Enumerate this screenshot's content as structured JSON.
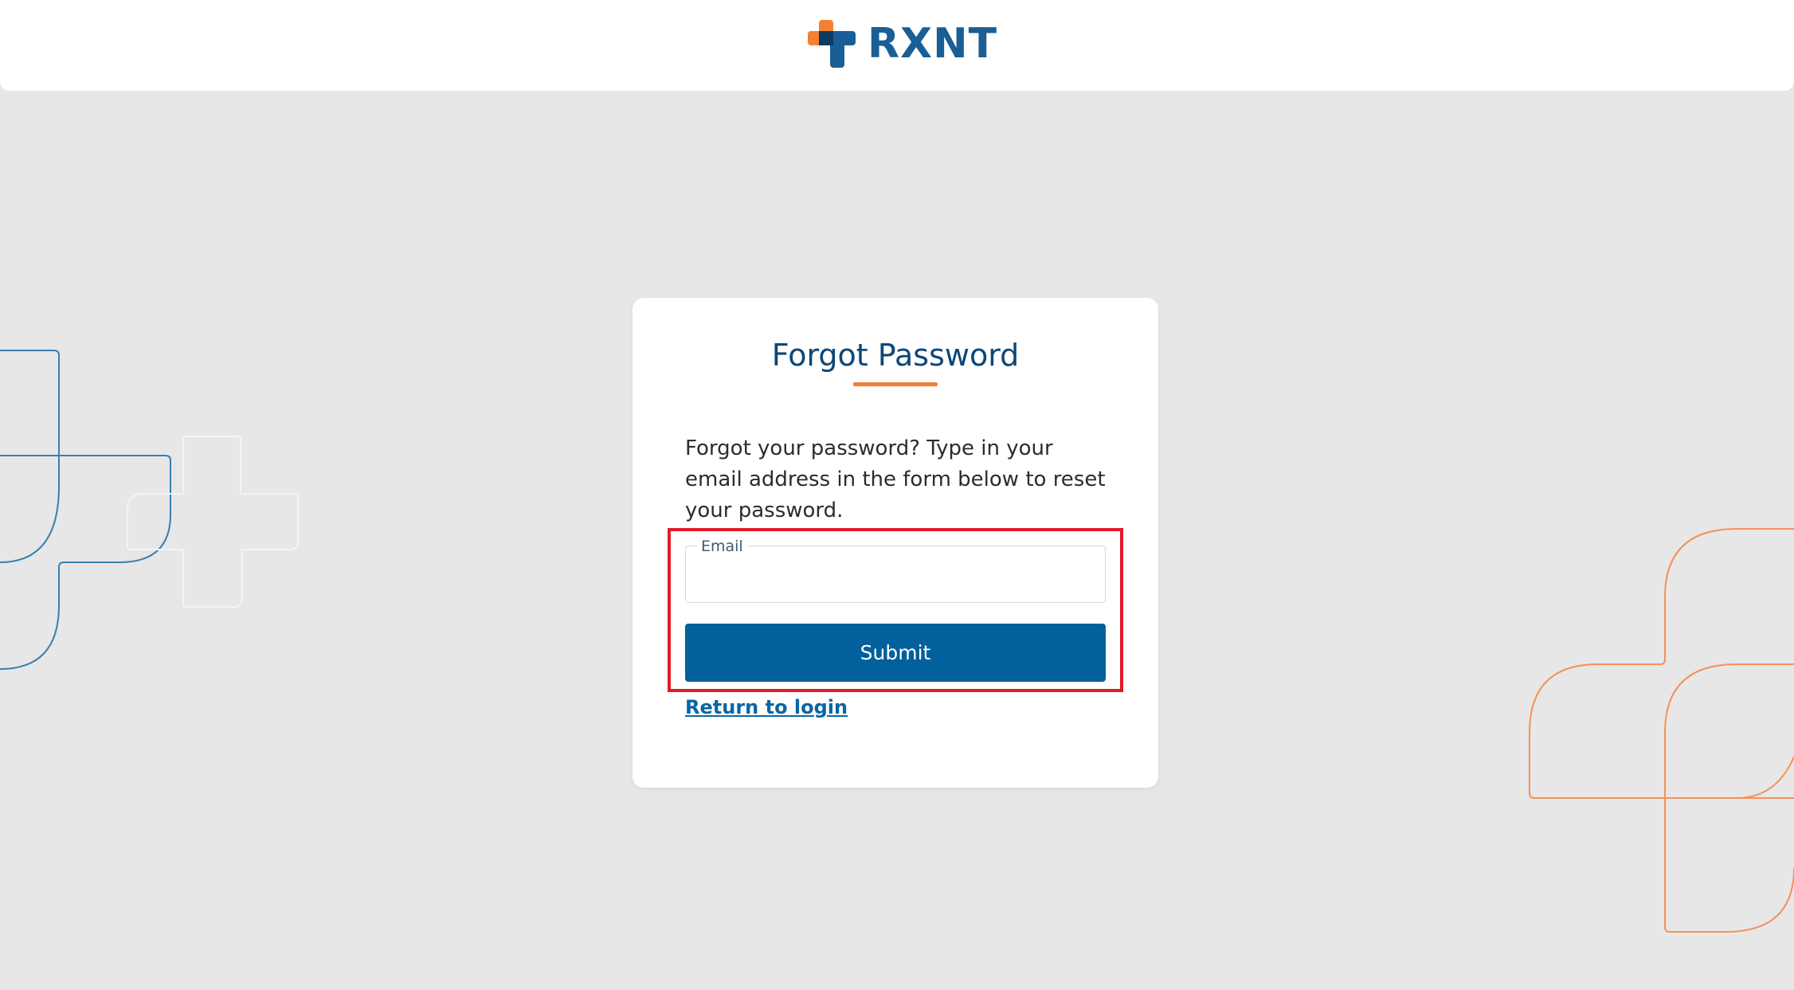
{
  "header": {
    "logo_text": "RXNT",
    "logo_icon": "rxnt-cross-logo-icon"
  },
  "forgot_password": {
    "title": "Forgot Password",
    "instructions": "Forgot your password? Type in your email address in the form below to reset your password.",
    "email_label": "Email",
    "email_value": "",
    "submit_label": "Submit",
    "return_link": "Return to login"
  },
  "colors": {
    "brand_blue": "#1a5e96",
    "brand_orange": "#f57f33",
    "button_blue": "#02609c",
    "background": "#e7e7e7",
    "highlight_red": "#df1c2a"
  }
}
